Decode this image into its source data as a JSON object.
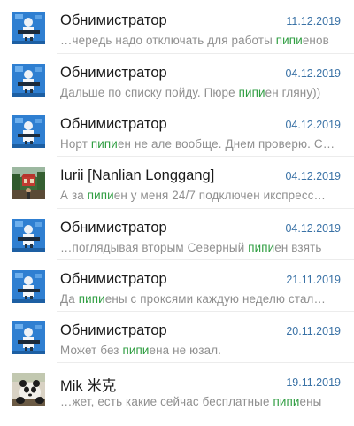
{
  "colors": {
    "name": "#1a1a1a",
    "date": "#3a72a6",
    "preview": "#8f8f8f",
    "highlight": "#2e9d40",
    "divider": "#ececec"
  },
  "search_term": "пипи",
  "results": [
    {
      "avatar": "obnimistrator-avatar",
      "name": "Обнимистратор",
      "date": "11.12.2019",
      "preview_before": "…черeдь надо отключать для работы ",
      "preview_match": "пипи",
      "preview_after": "енов"
    },
    {
      "avatar": "obnimistrator-avatar",
      "name": "Обнимистратор",
      "date": "04.12.2019",
      "preview_before": "Дальше по списку пойду. Пюре ",
      "preview_match": "пипи",
      "preview_after": "ен гляну))"
    },
    {
      "avatar": "obnimistrator-avatar",
      "name": "Обнимистратор",
      "date": "04.12.2019",
      "preview_before": "Норт ",
      "preview_match": "пипи",
      "preview_after": "ен не але вообще. Днем проверю. С…"
    },
    {
      "avatar": "iurii-avatar",
      "name": "Iurii [Nanlian Longgang]",
      "date": "04.12.2019",
      "preview_before": "А за ",
      "preview_match": "пипи",
      "preview_after": "ен у меня 24/7 подключен икспресс…"
    },
    {
      "avatar": "obnimistrator-avatar",
      "name": "Обнимистратор",
      "date": "04.12.2019",
      "preview_before": "…поглядывая вторым Северный ",
      "preview_match": "пипи",
      "preview_after": "ен взять"
    },
    {
      "avatar": "obnimistrator-avatar",
      "name": "Обнимистратор",
      "date": "21.11.2019",
      "preview_before": "Да ",
      "preview_match": "пипи",
      "preview_after": "ены с проксями каждую неделю стал…"
    },
    {
      "avatar": "obnimistrator-avatar",
      "name": "Обнимистратор",
      "date": "20.11.2019",
      "preview_before": "Может без ",
      "preview_match": "пипи",
      "preview_after": "ена не юзал."
    },
    {
      "avatar": "mik-avatar",
      "name": "Mik 米克",
      "date": "19.11.2019",
      "preview_before": "…жет,  есть какие сейчас бесплатные ",
      "preview_match": "пипи",
      "preview_after": "ены"
    }
  ]
}
